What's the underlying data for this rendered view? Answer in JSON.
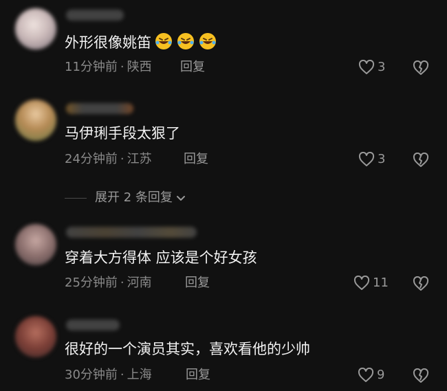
{
  "comments": [
    {
      "text": "外形很像姚笛",
      "time": "11分钟前",
      "location": "陕西",
      "reply_label": "回复",
      "likes": "3",
      "emoji": "rolling-on-floor-laughing"
    },
    {
      "text": "马伊琍手段太狠了",
      "time": "24分钟前",
      "location": "江苏",
      "reply_label": "回复",
      "likes": "3"
    },
    {
      "text": "穿着大方得体 应该是个好女孩",
      "time": "25分钟前",
      "location": "河南",
      "reply_label": "回复",
      "likes": "11"
    },
    {
      "text": "很好的一个演员其实，喜欢看他的少帅",
      "time": "30分钟前",
      "location": "上海",
      "reply_label": "回复",
      "likes": "9"
    }
  ],
  "meta_separator": "·",
  "expand_replies_label": "展开 2 条回复",
  "colors": {
    "background": "#111111",
    "text": "#f2f2f2",
    "muted": "#8a8a8a",
    "emoji": "#f7c021"
  }
}
